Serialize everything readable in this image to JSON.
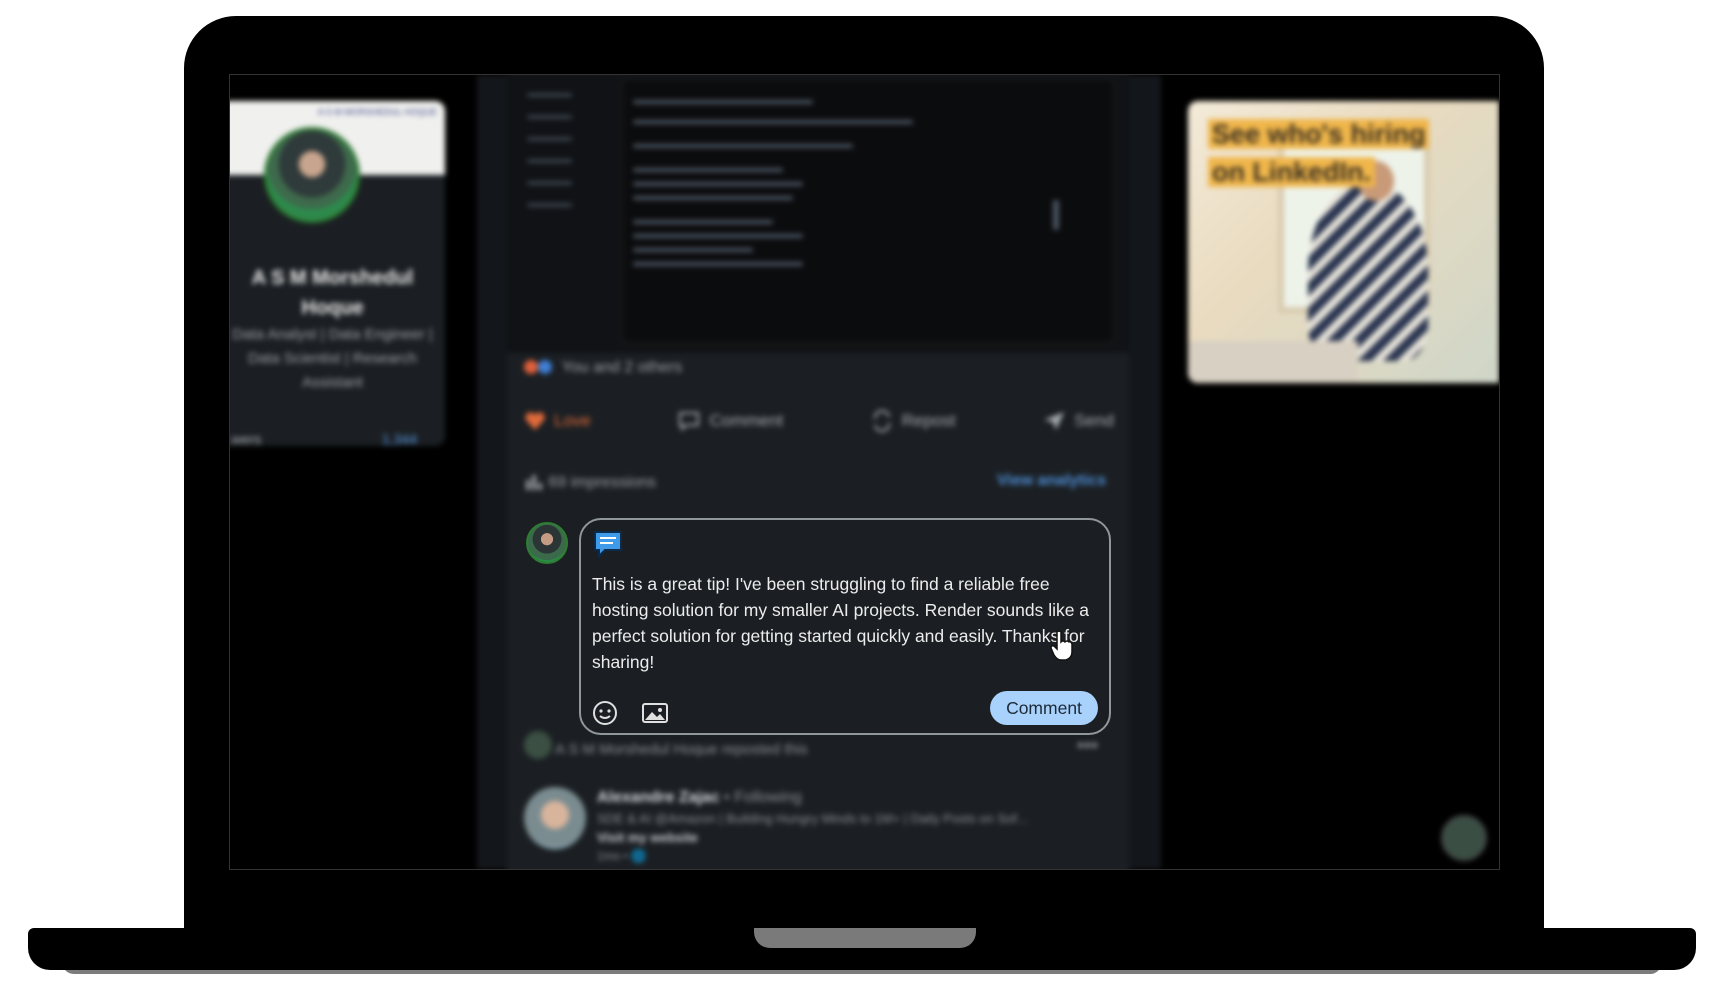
{
  "profile": {
    "banner_text": "A S M MORSHEDUL HOQUE",
    "name": "A S M Morshedul Hoque",
    "headline": "Data Analyst | Data Engineer | Data Scientist | Research Assistant",
    "bottom_left": "...wers",
    "bottom_right": "1,344"
  },
  "post": {
    "reactions_text": "You and 2 others",
    "actions": [
      {
        "label": "Love",
        "icon": "heart-icon"
      },
      {
        "label": "Comment",
        "icon": "comment-icon"
      },
      {
        "label": "Repost",
        "icon": "repost-icon"
      },
      {
        "label": "Send",
        "icon": "send-icon"
      }
    ],
    "impressions": "69 impressions",
    "view_analytics": "View analytics"
  },
  "comment_box": {
    "text": "This is a great tip! I've been struggling to find a reliable free hosting solution for my smaller AI projects. Render sounds like a perfect solution for getting started quickly and easily. Thanks for sharing!",
    "submit_label": "Comment"
  },
  "repost": {
    "line": "A S M Morshedul Hoque reposted this",
    "author_name": "Alexandre Zajac",
    "author_follow": " • Following",
    "author_headline": "SDE & AI @Amazon | Building Hungry Minds to 1M+ | Daily Posts on Sof...",
    "author_site": "Visit my website",
    "author_time": "1mo • 🌐"
  },
  "ad": {
    "line1": "See who's hiring",
    "line2": "on LinkedIn."
  },
  "colors": {
    "accent": "#a8d1fb",
    "link": "#4f8fd8",
    "card_bg": "#1b1f23"
  }
}
